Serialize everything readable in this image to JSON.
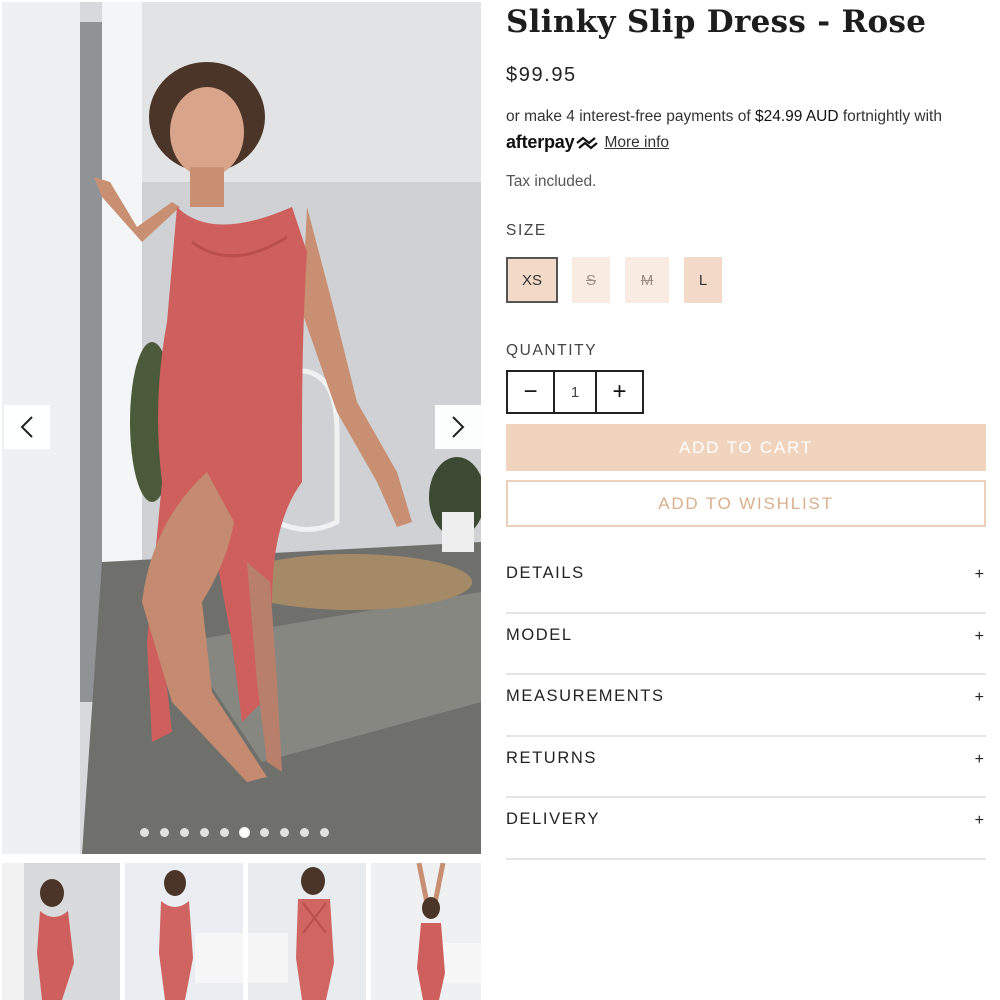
{
  "product": {
    "title": "Slinky Slip Dress - Rose",
    "price": "$99.95",
    "tax_note": "Tax included."
  },
  "afterpay": {
    "line_prefix": "or make 4 interest-free payments of ",
    "amount": "$24.99 AUD",
    "line_suffix": " fortnightly with",
    "logo_text": "afterpay",
    "more_info": "More info"
  },
  "size": {
    "label": "SIZE",
    "options": [
      {
        "label": "XS",
        "state": "selected"
      },
      {
        "label": "S",
        "state": "sold-out"
      },
      {
        "label": "M",
        "state": "sold-out"
      },
      {
        "label": "L",
        "state": "available"
      }
    ]
  },
  "quantity": {
    "label": "QUANTITY",
    "value": "1",
    "decrement_symbol": "−",
    "increment_symbol": "+"
  },
  "actions": {
    "add_to_cart": "ADD TO CART",
    "add_to_wishlist": "ADD TO WISHLIST"
  },
  "accordion": [
    {
      "label": "DETAILS",
      "icon": "+"
    },
    {
      "label": "MODEL",
      "icon": "+"
    },
    {
      "label": "MEASUREMENTS",
      "icon": "+"
    },
    {
      "label": "RETURNS",
      "icon": "+"
    },
    {
      "label": "DELIVERY",
      "icon": "+"
    }
  ],
  "gallery": {
    "slide_count": 10,
    "active_slide": 6,
    "thumbnail_count": 4,
    "icons": {
      "prev": "chevron-left-icon",
      "next": "chevron-right-icon"
    }
  },
  "colors": {
    "accent_peach": "#f1d4bd",
    "wishlist_text": "#d9b08d",
    "dress_rose": "#cf5f5c"
  }
}
